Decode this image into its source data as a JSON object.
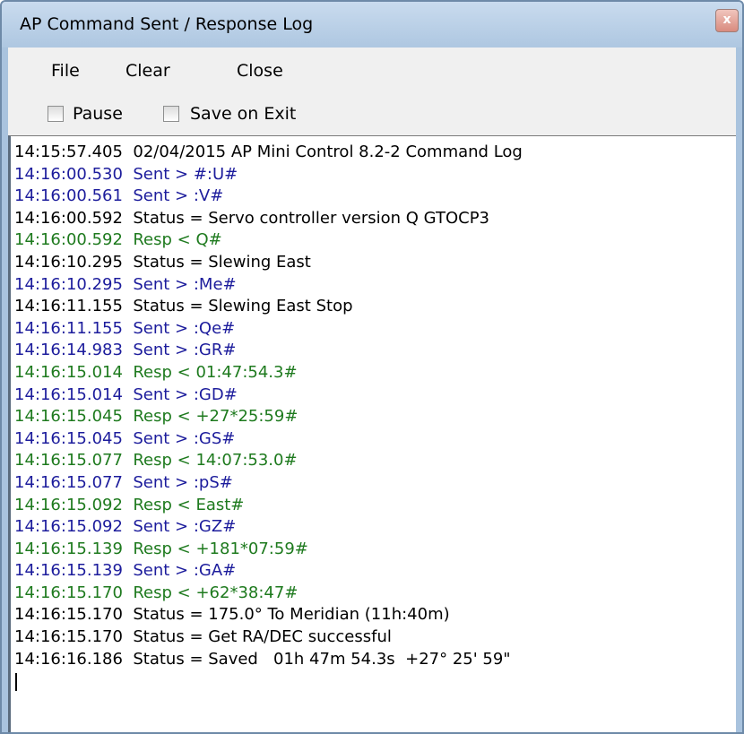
{
  "window": {
    "title": "AP Command Sent / Response Log",
    "close_glyph": "x"
  },
  "menu": {
    "file": "File",
    "clear": "Clear",
    "close": "Close"
  },
  "options": {
    "pause": {
      "label": "Pause",
      "checked": false
    },
    "save_on_exit": {
      "label": "Save on Exit",
      "checked": false
    }
  },
  "colors": {
    "status": "#000000",
    "sent": "#1c1c9c",
    "resp": "#1e7a1e"
  },
  "log": [
    {
      "type": "status",
      "text": "14:15:57.405  02/04/2015 AP Mini Control 8.2-2 Command Log"
    },
    {
      "type": "sent",
      "text": "14:16:00.530  Sent > #:U#"
    },
    {
      "type": "sent",
      "text": "14:16:00.561  Sent > :V#"
    },
    {
      "type": "status",
      "text": "14:16:00.592  Status = Servo controller version Q GTOCP3"
    },
    {
      "type": "resp",
      "text": "14:16:00.592  Resp < Q#"
    },
    {
      "type": "status",
      "text": "14:16:10.295  Status = Slewing East"
    },
    {
      "type": "sent",
      "text": "14:16:10.295  Sent > :Me#"
    },
    {
      "type": "status",
      "text": "14:16:11.155  Status = Slewing East Stop"
    },
    {
      "type": "sent",
      "text": "14:16:11.155  Sent > :Qe#"
    },
    {
      "type": "sent",
      "text": "14:16:14.983  Sent > :GR#"
    },
    {
      "type": "resp",
      "text": "14:16:15.014  Resp < 01:47:54.3#"
    },
    {
      "type": "sent",
      "text": "14:16:15.014  Sent > :GD#"
    },
    {
      "type": "resp",
      "text": "14:16:15.045  Resp < +27*25:59#"
    },
    {
      "type": "sent",
      "text": "14:16:15.045  Sent > :GS#"
    },
    {
      "type": "resp",
      "text": "14:16:15.077  Resp < 14:07:53.0#"
    },
    {
      "type": "sent",
      "text": "14:16:15.077  Sent > :pS#"
    },
    {
      "type": "resp",
      "text": "14:16:15.092  Resp < East#"
    },
    {
      "type": "sent",
      "text": "14:16:15.092  Sent > :GZ#"
    },
    {
      "type": "resp",
      "text": "14:16:15.139  Resp < +181*07:59#"
    },
    {
      "type": "sent",
      "text": "14:16:15.139  Sent > :GA#"
    },
    {
      "type": "resp",
      "text": "14:16:15.170  Resp < +62*38:47#"
    },
    {
      "type": "status",
      "text": "14:16:15.170  Status = 175.0° To Meridian (11h:40m)"
    },
    {
      "type": "status",
      "text": "14:16:15.170  Status = Get RA/DEC successful"
    },
    {
      "type": "status",
      "text": "14:16:16.186  Status = Saved   01h 47m 54.3s  +27° 25' 59\""
    }
  ]
}
